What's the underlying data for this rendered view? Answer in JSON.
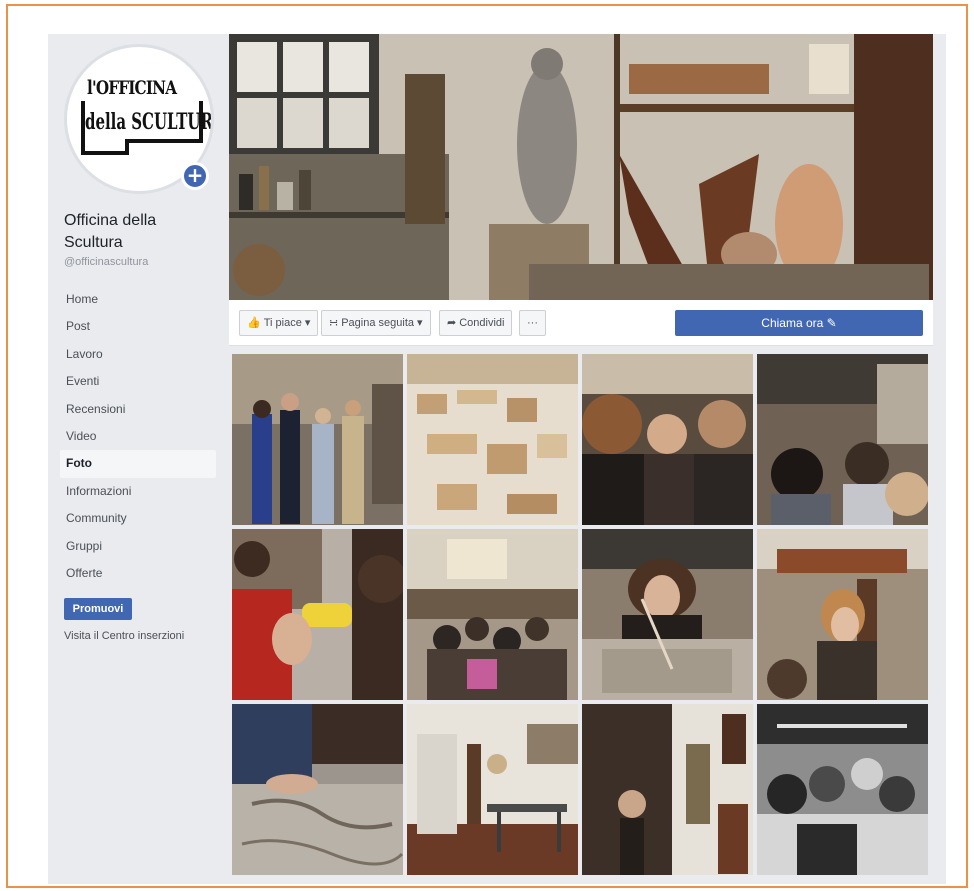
{
  "page": {
    "name": "Officina della Scultura",
    "handle": "@officinascultura",
    "logo_line1": "l'OFFICINA",
    "logo_line2": "della SCULTURA"
  },
  "sidebar": {
    "items": [
      {
        "label": "Home"
      },
      {
        "label": "Post"
      },
      {
        "label": "Lavoro"
      },
      {
        "label": "Eventi"
      },
      {
        "label": "Recensioni"
      },
      {
        "label": "Video"
      },
      {
        "label": "Foto",
        "active": true
      },
      {
        "label": "Informazioni"
      },
      {
        "label": "Community"
      },
      {
        "label": "Gruppi"
      },
      {
        "label": "Offerte"
      }
    ],
    "promote_label": "Promuovi",
    "ads_center_label": "Visita il Centro inserzioni"
  },
  "actions": {
    "like_label": "Ti piace",
    "follow_label": "Pagina seguita",
    "share_label": "Condividi",
    "more_label": "···",
    "call_label": "Chiama ora"
  },
  "icons": {
    "like": "thumbs-up-icon",
    "follow": "rss-icon",
    "share": "share-arrow-icon",
    "edit": "pencil-icon",
    "add": "plus-icon"
  },
  "colors": {
    "accent": "#4267b2",
    "frame_border": "#e8924a",
    "page_bg": "#e9ebee"
  }
}
